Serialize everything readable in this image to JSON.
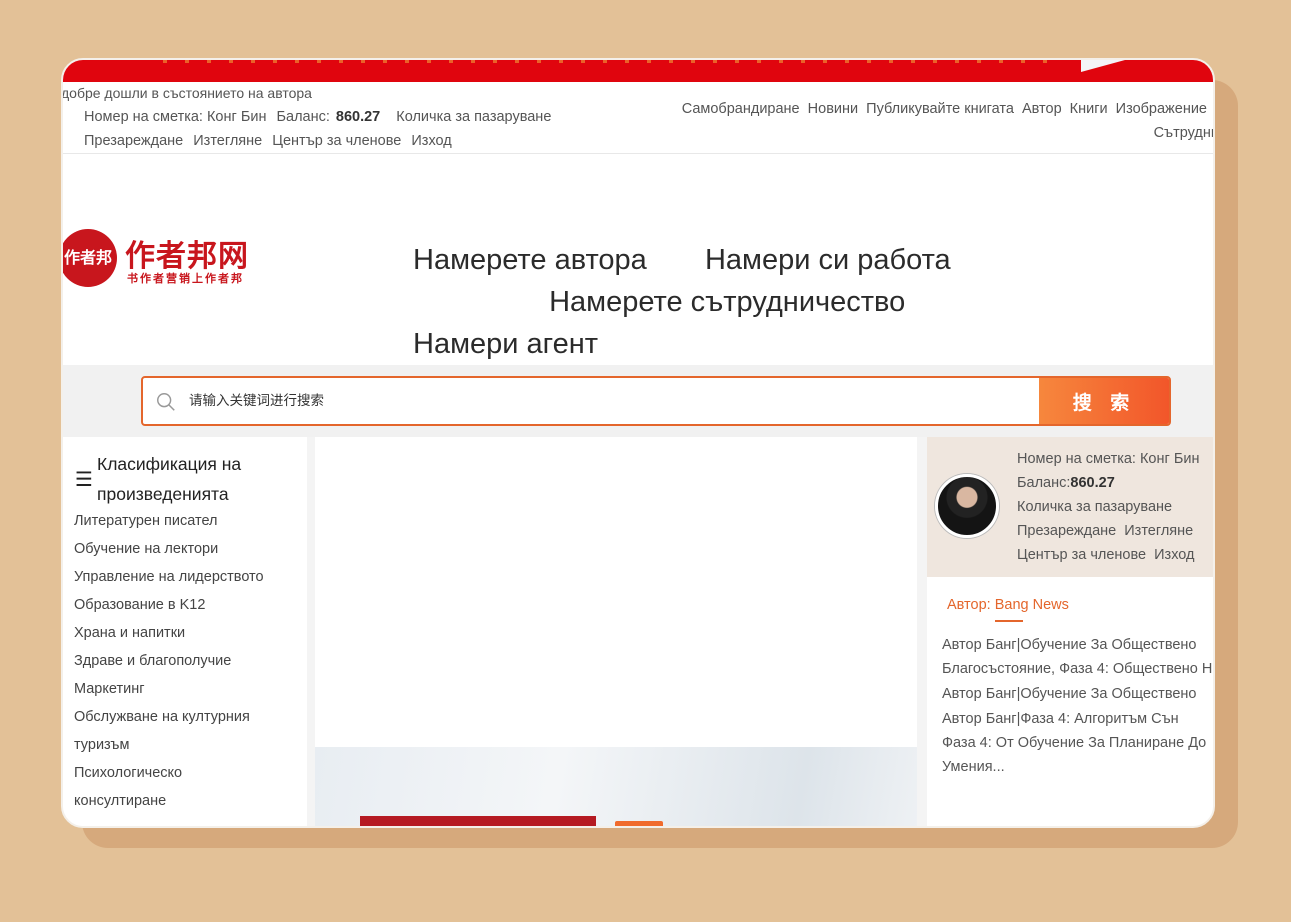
{
  "topbar": {
    "welcome": "добре дошли в състоянието на автора",
    "account_label": "Номер на сметка: Конг Бин",
    "balance_label": "Баланс:",
    "balance_value": "860.27",
    "cart": "Количка за пазаруване",
    "recharge": "Презареждане",
    "withdraw": "Изтегляне",
    "member_center": "Център за членове",
    "logout": "Изход",
    "nav": [
      "Самобрандиране",
      "Новини",
      "Публикувайте книгата",
      "Автор",
      "Книги",
      "Изображение",
      "Сътрудни"
    ]
  },
  "logo": {
    "mark": "作者邦",
    "title": "作者邦网",
    "slogan": "书作者营销上作者邦"
  },
  "mainnav": [
    "Намерете автора",
    "Намери си работа",
    "Намерете сътрудничество",
    "Намери агент"
  ],
  "search": {
    "placeholder": "请输入关键词进行搜索",
    "button": "搜 索"
  },
  "sidebar": {
    "title": "Класификация на произведенията",
    "categories": [
      "Литературен писател",
      "Обучение на лектори",
      "Управление на лидерството",
      "Образование в K12",
      "Храна и напитки",
      "Здраве и благополучие",
      "Маркетинг",
      "Обслужване на културния",
      "туризъм",
      "Психологическо",
      "консултиране"
    ]
  },
  "userpanel": {
    "account": "Номер на сметка: Конг Бин",
    "balance_label": "Баланс:",
    "balance_value": "860.27",
    "cart": "Количка за пазаруване",
    "recharge": "Презареждане",
    "withdraw": "Изтегляне",
    "member_center": "Център за членове",
    "logout": "Изход"
  },
  "news": {
    "tab": "Автор: Bang News",
    "lines": [
      "Автор Банг|Обучение За Обществено",
      "Благосъстояние, Фаза 4: Обществено Н",
      "Автор Банг|Обучение За Обществено",
      "Автор Банг|Фаза 4: Алгоритъм Сън",
      "Фаза 4: От Обучение За Планиране До",
      "Умения..."
    ]
  },
  "colors": {
    "accent": "#e4662c",
    "brand_red": "#c8161d",
    "banner_red": "#e0050e",
    "page_bg": "#e3c197"
  }
}
